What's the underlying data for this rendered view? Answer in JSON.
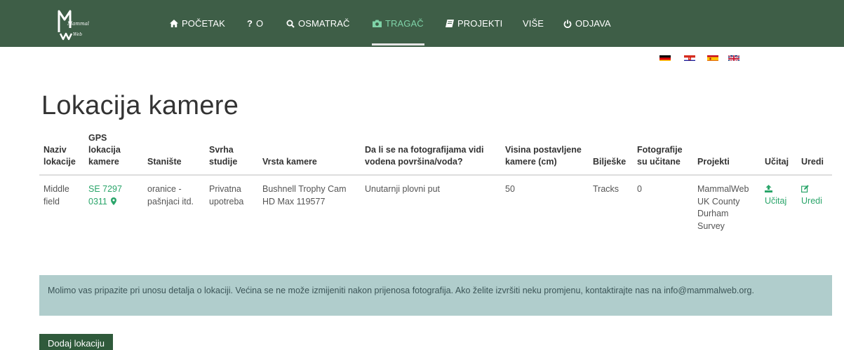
{
  "logo": {
    "line1": "Mammal",
    "line2": "Web"
  },
  "nav": [
    {
      "key": "home",
      "label": "POČETAK",
      "icon": "home-icon"
    },
    {
      "key": "about",
      "label": "O",
      "icon": "question-icon"
    },
    {
      "key": "spotter",
      "label": "OSMATRAČ",
      "icon": "search-icon"
    },
    {
      "key": "trapper",
      "label": "TRAGAČ",
      "icon": "camera-icon",
      "active": true
    },
    {
      "key": "projects",
      "label": "PROJEKTI",
      "icon": "book-icon"
    },
    {
      "key": "more",
      "label": "VIŠE",
      "icon": ""
    },
    {
      "key": "logout",
      "label": "ODJAVA",
      "icon": "power-icon"
    }
  ],
  "languages": [
    "de",
    "hr",
    "es",
    "gb"
  ],
  "page_title": "Lokacija kamere",
  "table": {
    "headers": [
      "Naziv lokacije",
      "GPS lokacija kamere",
      "Stanište",
      "Svrha studije",
      "Vrsta kamere",
      "Da li se na fotografijama vidi vodena površina/voda?",
      "Visina postavljene kamere (cm)",
      "Bilješke",
      "Fotografije su učitane",
      "Projekti",
      "Učitaj",
      "Uredi"
    ],
    "rows": [
      {
        "name": "Middle field",
        "gps": "SE 7297 0311",
        "habitat": "oranice - pašnjaci itd.",
        "purpose": "Privatna upotreba",
        "camera": "Bushnell Trophy Cam HD Max 119577",
        "water": "Unutarnji plovni put",
        "height": "50",
        "notes": "Tracks",
        "uploaded": "0",
        "project": "MammalWeb UK County Durham Survey",
        "upload_label": "Učitaj",
        "edit_label": "Uredi"
      }
    ]
  },
  "info_message": "Molimo vas pripazite pri unosu detalja o lokaciji. Većina se ne može izmijeniti nakon prijenosa fotografija. Ako želite izvršiti neku promjenu, kontaktirajte nas na info@mammalweb.org.",
  "add_button": "Dodaj lokaciju",
  "colors": {
    "navbar": "#3e5e47",
    "active": "#7fd3a8",
    "link": "#2aa56a",
    "info_bg": "#b0cdcc",
    "button": "#2f5a3b"
  }
}
